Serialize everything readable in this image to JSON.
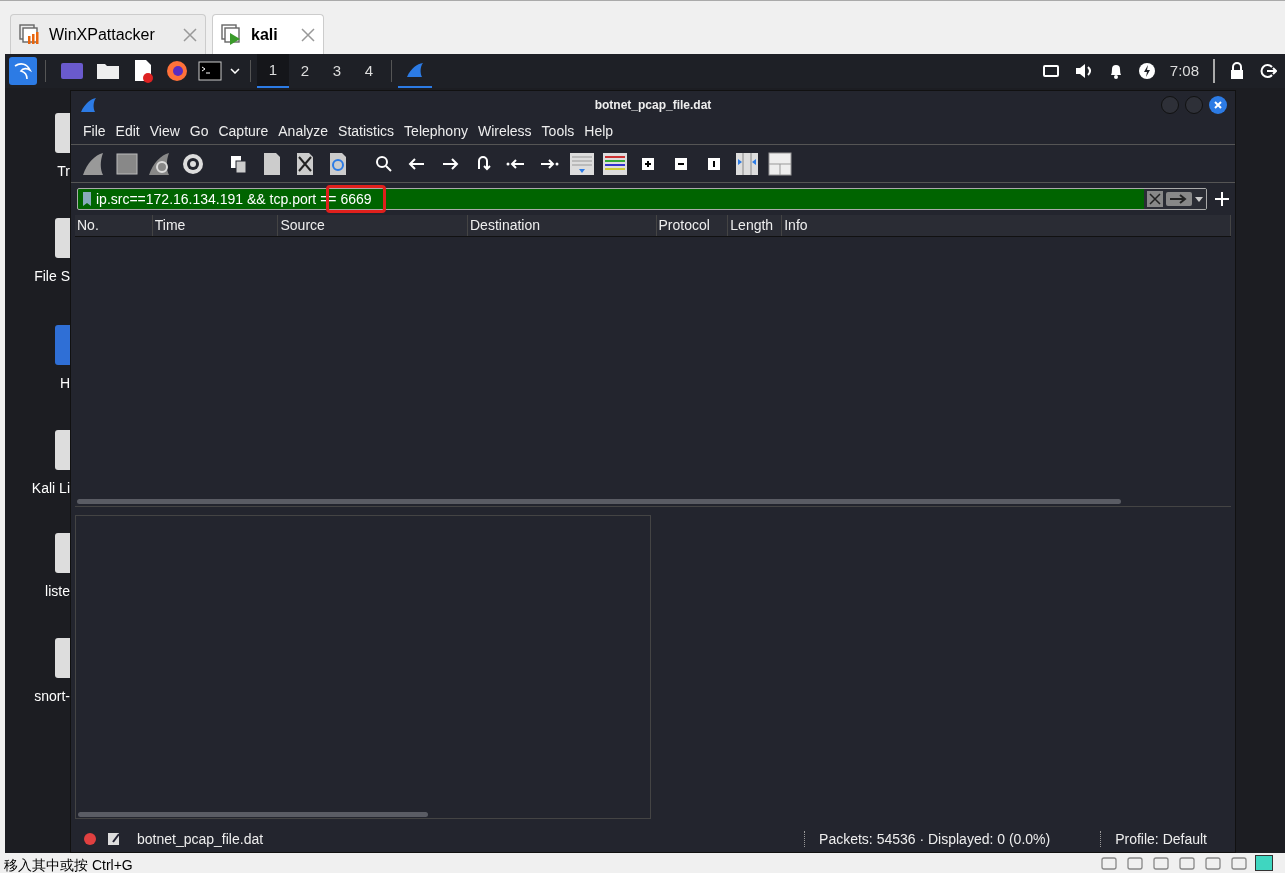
{
  "host_tabs": [
    {
      "label": "WinXPattacker",
      "selected": false
    },
    {
      "label": "kali",
      "selected": true
    }
  ],
  "panel": {
    "workspaces": [
      {
        "label": "1",
        "selected": true
      },
      {
        "label": "2",
        "selected": false
      },
      {
        "label": "3",
        "selected": false
      },
      {
        "label": "4",
        "selected": false
      }
    ],
    "clock": "7:08"
  },
  "desktop_icons": [
    {
      "label": "Tr"
    },
    {
      "label": "File S"
    },
    {
      "label": "H"
    },
    {
      "label": "Kali Li"
    },
    {
      "label": "liste"
    },
    {
      "label": "snort-"
    }
  ],
  "window": {
    "title": "botnet_pcap_file.dat",
    "menu": [
      "File",
      "Edit",
      "View",
      "Go",
      "Capture",
      "Analyze",
      "Statistics",
      "Telephony",
      "Wireless",
      "Tools",
      "Help"
    ],
    "filter": {
      "value": "ip.src==172.16.134.191 && tcp.port == 6669",
      "valid": true,
      "highlighted": true
    },
    "columns": [
      "No.",
      "Time",
      "Source",
      "Destination",
      "Protocol",
      "Length",
      "Info"
    ],
    "status_bar": {
      "file": "botnet_pcap_file.dat",
      "packets": "Packets: 54536 · Displayed: 0 (0.0%)",
      "profile": "Profile: Default"
    }
  },
  "host_status": {
    "hint": "移入其中或按 Ctrl+G"
  }
}
